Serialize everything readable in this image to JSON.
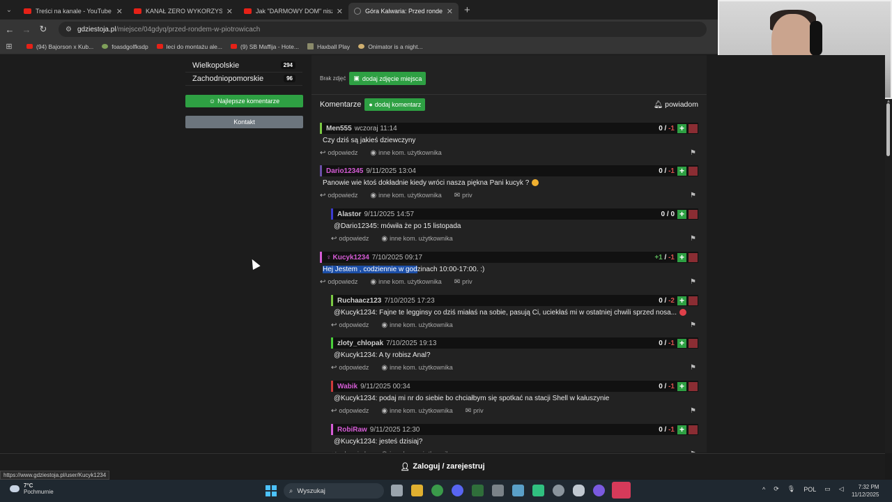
{
  "browser": {
    "tabs": [
      {
        "title": "Treści na kanale - YouTube Studio",
        "favicon": "youtube-icon",
        "active": false
      },
      {
        "title": "KANAŁ ZERO WYKORZYSTANY",
        "favicon": "youtube-icon",
        "active": false
      },
      {
        "title": "Jak \"DARMOWY DOM\" niszczy",
        "favicon": "youtube-icon",
        "active": false
      },
      {
        "title": "Góra Kalwaria: Przed rondem w",
        "favicon": "globe-icon",
        "active": true
      }
    ],
    "url_host": "gdziestoja.pl",
    "url_path": "/miejsce/04gdyq/przed-rondem-w-piotrowicach",
    "bookmarks": [
      {
        "label": "(94) Bajorson x Kub...",
        "icon": "youtube-icon"
      },
      {
        "label": "foasdgolfksdp",
        "icon": "green-icon"
      },
      {
        "label": "leci do montażu ale...",
        "icon": "youtube-icon"
      },
      {
        "label": "(9) SB Maffija - Hote...",
        "icon": "youtube-icon"
      },
      {
        "label": "Haxball Play",
        "icon": "haxball-icon"
      },
      {
        "label": "Onimator is a night...",
        "icon": "onimator-icon"
      }
    ]
  },
  "sidebar": {
    "regions": [
      {
        "name": "Wielkopolskie",
        "count": "294"
      },
      {
        "name": "Zachodniopomorskie",
        "count": "96"
      }
    ],
    "best_comments_label": "Najlepsze komentarze",
    "contact_label": "Kontakt"
  },
  "main": {
    "no_photos": "Brak zdjęć",
    "add_photo_label": "dodaj zdjęcie miejsca",
    "comments_title": "Komentarze",
    "add_comment_label": "dodaj komentarz",
    "notify_label": "powiadom",
    "reply_label": "odpowiedz",
    "other_comments_label": "inne kom. użytkownika",
    "priv_label": "priv",
    "comments": [
      {
        "user": "Men555",
        "date": "wczoraj 11:14",
        "plus": "0",
        "minus": "-1",
        "text": "Czy dziś są jakieś dziewczyny",
        "color": "#cfcfcf",
        "bar": "#7ac943",
        "priv": false,
        "indent": false
      },
      {
        "user": "Dario12345",
        "date": "9/11/2025 13:04",
        "plus": "0",
        "minus": "-1",
        "text": "Panowie wie ktoś dokładnie kiedy wróci nasza piękna Pani kucyk ?",
        "color": "#d65cd6",
        "bar": "#6b4fa8",
        "priv": true,
        "indent": false,
        "emoji": true
      },
      {
        "user": "Alastor",
        "date": "9/11/2025 14:57",
        "plus": "0",
        "minus": "0",
        "text": "@Dario12345: mówiła że po 15 listopada",
        "color": "#cfcfcf",
        "bar": "#3b3bd0",
        "priv": false,
        "indent": true
      },
      {
        "user": "Kucyk1234",
        "date": "7/10/2025 09:17",
        "plus": "+1",
        "minus": "-1",
        "text_selected": "Hej Jestem , codziennie w god",
        "text": "zinach 10:00-17:00. :)",
        "color": "#d65cd6",
        "bar": "#d65cd6",
        "priv": true,
        "indent": false
      },
      {
        "user": "Ruchaacz123",
        "date": "7/10/2025 17:23",
        "plus": "0",
        "minus": "-2",
        "text": "@Kucyk1234: Fajne te legginsy co dziś miałaś na sobie, pasują Ci, uciekłaś mi w ostatniej chwili sprzed nosa...",
        "color": "#cfcfcf",
        "bar": "#7ac943",
        "priv": false,
        "indent": true,
        "emoji_red": true
      },
      {
        "user": "zloty_chlopak",
        "date": "7/10/2025 19:13",
        "plus": "0",
        "minus": "-1",
        "text": "@Kucyk1234: A ty robisz Anal?",
        "color": "#cfcfcf",
        "bar": "#4ad03a",
        "priv": false,
        "indent": true
      },
      {
        "user": "Wabik",
        "date": "9/11/2025 00:34",
        "plus": "0",
        "minus": "-1",
        "text": "@Kucyk1234: podaj mi nr do siebie bo chciałbym się spotkać na stacji Shell w kałuszynie",
        "color": "#d65cd6",
        "bar": "#d03a3a",
        "priv": true,
        "indent": true
      },
      {
        "user": "RobiRaw",
        "date": "9/11/2025 12:30",
        "plus": "0",
        "minus": "-1",
        "text": "@Kucyk1234: jesteś dzisiaj?",
        "color": "#d65cd6",
        "bar": "#d65cd6",
        "priv": false,
        "indent": true
      }
    ]
  },
  "login_label": "Zaloguj / zarejestruj",
  "status_url": "https://www.gdziestoja.pl/user/Kucyk1234",
  "taskbar": {
    "temperature": "7°C",
    "weather": "Pochmurnie",
    "search_placeholder": "Wyszukaj",
    "language": "POL",
    "time": "7:32 PM",
    "date": "11/12/2025"
  }
}
